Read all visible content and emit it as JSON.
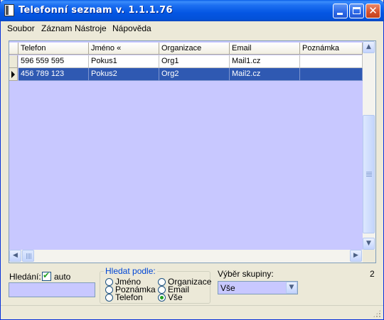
{
  "window": {
    "title": "Telefonní seznam v. 1.1.1.76"
  },
  "menu": [
    {
      "label": "Soubor"
    },
    {
      "label": "Záznam"
    },
    {
      "label": "Nástroje"
    },
    {
      "label": "Nápověda"
    }
  ],
  "grid": {
    "columns": [
      "Telefon",
      "Jméno  «",
      "Organizace",
      "Email",
      "Poznámka"
    ],
    "rows": [
      {
        "telefon": "596 559 595",
        "jmeno": "Pokus1",
        "organizace": "Org1",
        "email": "Mail1.cz",
        "poznamka": "",
        "selected": false
      },
      {
        "telefon": "456 789 123",
        "jmeno": "Pokus2",
        "organizace": "Org2",
        "email": "Mail2.cz",
        "poznamka": "",
        "selected": true
      }
    ]
  },
  "search": {
    "label": "Hledání:",
    "auto_label": "auto",
    "auto_checked": true,
    "value": ""
  },
  "search_by": {
    "title": "Hledat podle:",
    "options": [
      "Jméno",
      "Poznámka",
      "Telefon",
      "Organizace",
      "Email",
      "Vše"
    ],
    "selected": "Vše"
  },
  "group": {
    "label": "Výběr skupiny:",
    "selected": "Vše"
  },
  "record_count": "2",
  "colors": {
    "titlebar": "#0456e3",
    "grid_background": "#c8c8ff",
    "selected_row": "#2f59b2",
    "window_face": "#ece9d8"
  }
}
